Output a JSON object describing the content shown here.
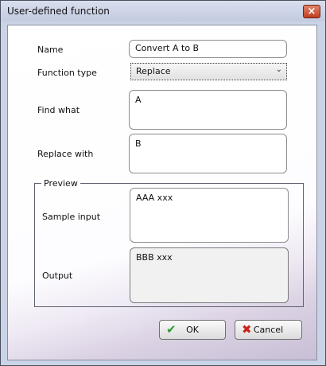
{
  "window": {
    "title": "User-defined function",
    "close_glyph": "×"
  },
  "form": {
    "name_label": "Name",
    "name_value": "Convert A to B",
    "function_type_label": "Function type",
    "function_type_value": "Replace",
    "find_label": "Find what",
    "find_value": "A",
    "replace_label": "Replace with",
    "replace_value": "B"
  },
  "preview": {
    "legend": "Preview",
    "sample_label": "Sample input",
    "sample_value": "AAA xxx",
    "output_label": "Output",
    "output_value": "BBB xxx"
  },
  "buttons": {
    "ok_label": "OK",
    "cancel_label": "Cancel"
  },
  "icons": {
    "ok_icon": "check-icon",
    "cancel_icon": "cross-icon",
    "ok_color": "#2e9b2e",
    "cancel_color": "#c8261a"
  }
}
